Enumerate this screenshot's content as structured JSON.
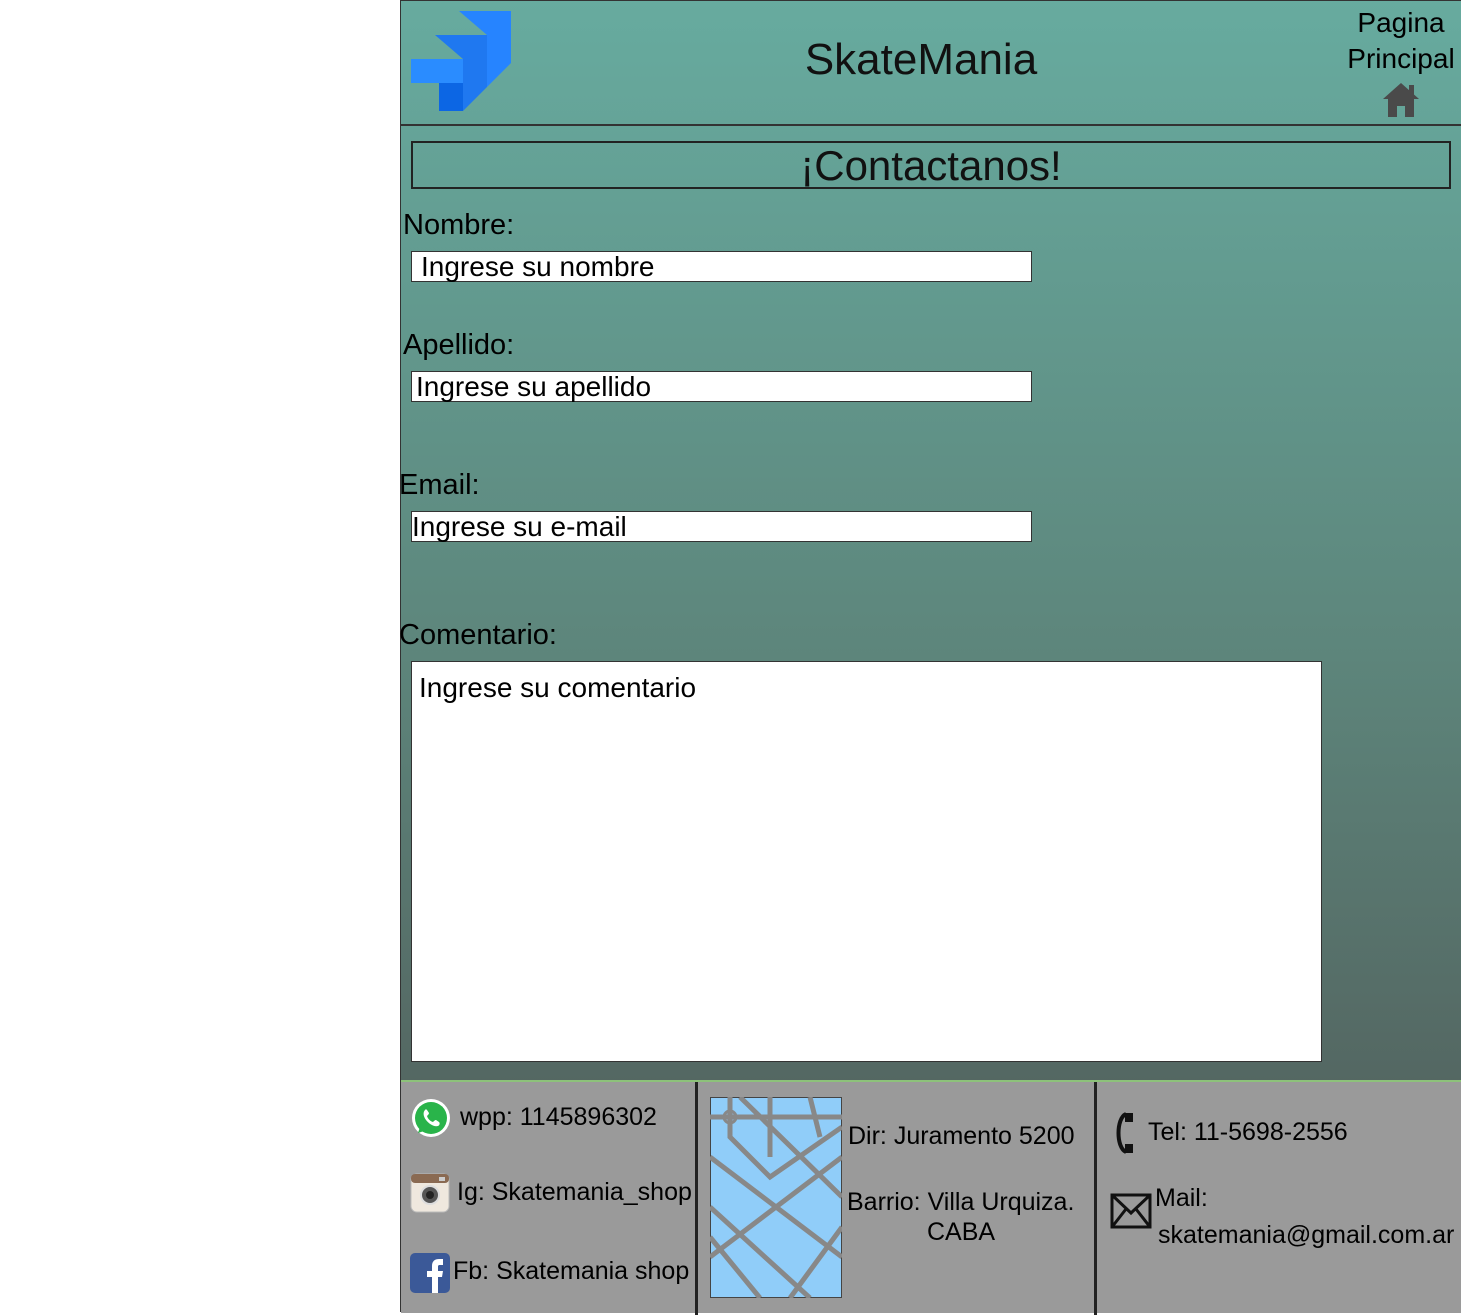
{
  "header": {
    "brand": "SkateMania",
    "home_line1": "Pagina",
    "home_line2": "Principal"
  },
  "section_title": "¡Contactanos!",
  "form": {
    "nombre_label": "Nombre:",
    "nombre_placeholder": "Ingrese su nombre",
    "apellido_label": "Apellido:",
    "apellido_placeholder": "Ingrese su apellido",
    "email_label": "Email:",
    "email_placeholder": "Ingrese su e-mail",
    "comentario_label": "Comentario:",
    "comentario_placeholder": "Ingrese su comentario"
  },
  "footer": {
    "whatsapp": "wpp: 1145896302",
    "instagram": "Ig: Skatemania_shop",
    "facebook": "Fb: Skatemania shop",
    "address": "Dir: Juramento 5200",
    "barrio_line1": "Barrio: Villa Urquiza.",
    "barrio_line2": "CABA",
    "tel": "Tel: 11-5698-2556",
    "mail_label": "Mail:",
    "mail_value": "skatemania@gmail.com.ar"
  },
  "colors": {
    "header_green": "#67ab9f",
    "footer_gray": "#9a9a9a",
    "logo_blue": "#2684ff"
  }
}
